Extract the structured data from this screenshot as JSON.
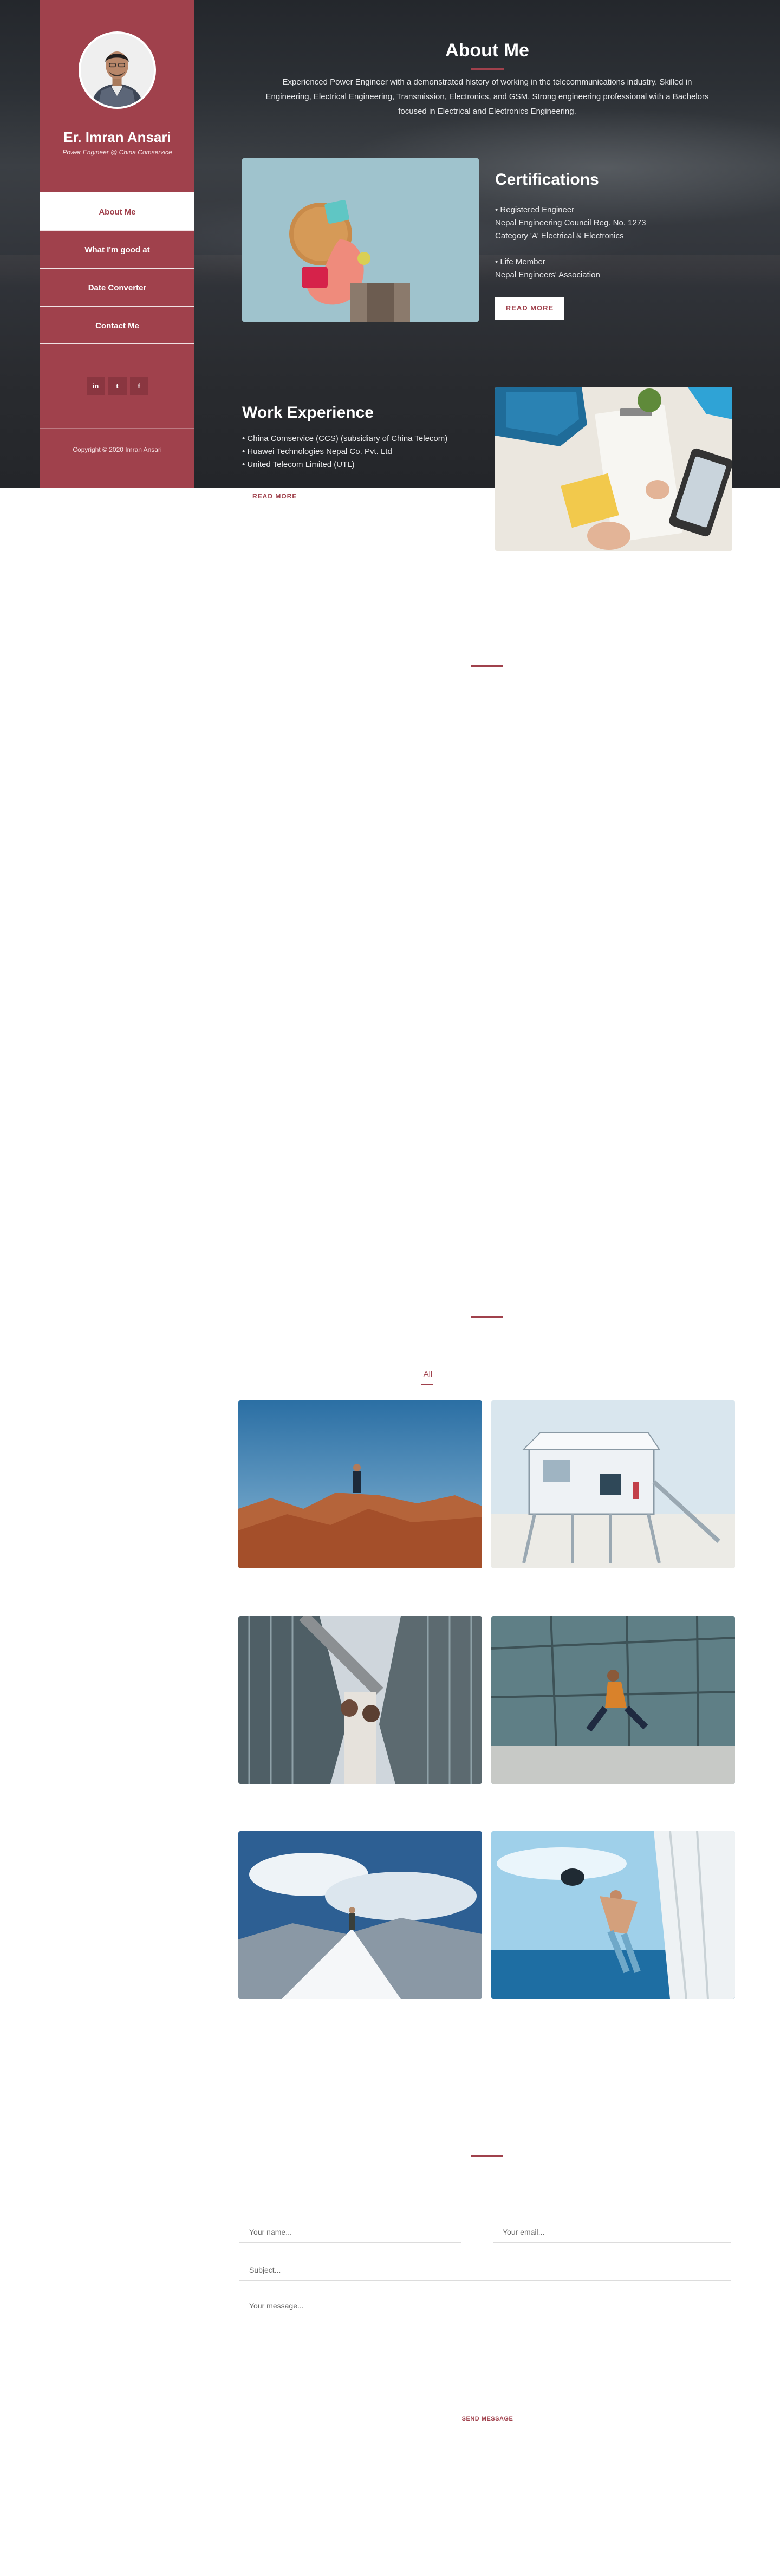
{
  "sidebar": {
    "name": "Er. Imran Ansari",
    "role": "Power Engineer @ China Comservice",
    "menu": [
      {
        "label": "About Me"
      },
      {
        "label": "What I'm good at"
      },
      {
        "label": "Date Converter"
      },
      {
        "label": "Contact Me"
      }
    ],
    "social": [
      {
        "icon": "linkedin-icon",
        "glyph": "in"
      },
      {
        "icon": "twitter-icon",
        "glyph": "t"
      },
      {
        "icon": "facebook-icon",
        "glyph": "f"
      }
    ],
    "copyright": "Copyright © 2020 Imran Ansari"
  },
  "about": {
    "title": "About Me",
    "intro": "Experienced Power Engineer with a demonstrated history of working in the telecommunications industry. Skilled in Engineering, Electrical Engineering, Transmission, Electronics, and GSM. Strong engineering professional with a Bachelors focused in Electrical and Electronics Engineering."
  },
  "certifications": {
    "title": "Certifications",
    "lines_a": [
      "• Registered Engineer",
      "Nepal Engineering Council Reg. No. 1273",
      "Category 'A' Electrical & Electronics"
    ],
    "lines_b": [
      "• Life Member",
      "Nepal Engineers' Association"
    ],
    "button": "READ MORE"
  },
  "work": {
    "title": "Work Experience",
    "items": [
      "• China Comservice (CCS) (subsidiary of China Telecom)",
      "• Huawei Technologies Nepal Co. Pvt. Ltd",
      "• United Telecom Limited (UTL)"
    ],
    "button": "READ MORE"
  },
  "gallery": {
    "filter": "All"
  },
  "contact": {
    "name_placeholder": "Your name...",
    "email_placeholder": "Your email...",
    "subject_placeholder": "Subject...",
    "message_placeholder": "Your message...",
    "send": "SEND MESSAGE"
  },
  "colors": {
    "accent": "#a0414c",
    "hero_background": "#2c3035"
  }
}
